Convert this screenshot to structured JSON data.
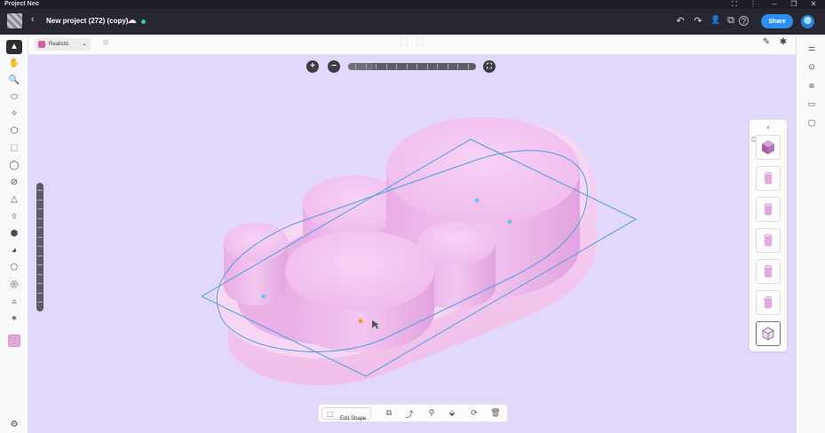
{
  "window": {
    "title": "Project Neo",
    "controls": {
      "screen": "⛶",
      "more": "⋮",
      "minimize": "–",
      "restore": "❐",
      "close": "✕"
    }
  },
  "topbar": {
    "back": "‹",
    "project_title": "New project (272) (copy)",
    "cloud": "☁",
    "undo": "↶",
    "redo": "↷",
    "user": "👤",
    "present": "⧉",
    "help": "?",
    "share_label": "Share"
  },
  "toolbar_left": [
    "▲",
    "✋",
    "🔍",
    "⬭",
    "✧",
    "⬡",
    "⬚",
    "◯",
    "⊘",
    "△",
    "⬨",
    "⬢",
    "◕",
    "⬠",
    "◎",
    "▵",
    "✶"
  ],
  "toolbar_left_icons": [
    "select-arrow-icon",
    "hand-icon",
    "search-icon",
    "plane-icon",
    "move-icon",
    "cube-icon",
    "cylinder-icon",
    "sphere-icon",
    "capsule-icon",
    "cone-icon",
    "drop-icon",
    "box-outline-icon",
    "torus-icon",
    "prism-icon",
    "ring-icon",
    "pyramid-icon",
    "star-icon"
  ],
  "settings_icon": "⚙",
  "secondary": {
    "render_mode": "Realistic",
    "chevron": "⌄",
    "light": "☼",
    "frame_a": "⬚",
    "frame_b": "⬚",
    "pen": "✎",
    "magic": "✱"
  },
  "toolbar_right": [
    "⚌",
    "⊙",
    "⧈",
    "▭",
    "▢"
  ],
  "toolbar_right_icons": [
    "sliders-icon",
    "materials-icon",
    "layers-icon",
    "camera-icon",
    "comment-icon"
  ],
  "zoom": {
    "plus": "+",
    "minus": "−",
    "fit": "⛶",
    "level": 0.2
  },
  "shape_panel": {
    "collapse": "‹",
    "info": "i",
    "items": [
      "cube",
      "cylinder",
      "cylinder",
      "cylinder",
      "cylinder",
      "cylinder",
      "cube-outline"
    ]
  },
  "bottom_bar": {
    "edit_shape_label": "Edit Shape",
    "edit_icon": "⬚",
    "tools": [
      "⧉",
      "⤴",
      "⚲",
      "⬙",
      "⟳",
      "🗑"
    ],
    "tool_icons": [
      "duplicate-icon",
      "export-icon",
      "eyedropper-icon",
      "paint-icon",
      "replace-icon",
      "delete-icon"
    ]
  },
  "colors": {
    "shape": "#f0c2ee",
    "tray": "#f4c8f0",
    "selection": "#4aa0e0",
    "accent_orange": "#f39a3a",
    "share": "#2b8ef0"
  }
}
